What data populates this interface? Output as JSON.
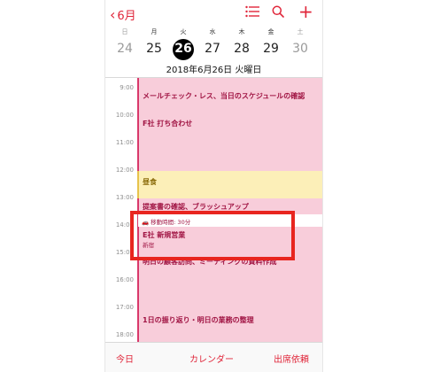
{
  "nav": {
    "back_label": "6月"
  },
  "week": {
    "weekdays": [
      "日",
      "月",
      "火",
      "水",
      "木",
      "金",
      "土"
    ],
    "dates": [
      "24",
      "25",
      "26",
      "27",
      "28",
      "29",
      "30"
    ],
    "selected_index": 2
  },
  "selected_date_caption": "2018年6月26日 火曜日",
  "timeline": {
    "hours": [
      "9:00",
      "10:00",
      "11:00",
      "12:00",
      "13:00",
      "14:00",
      "15:00",
      "16:00",
      "17:00",
      "18:00"
    ]
  },
  "events": [
    {
      "title": "メールチェック・レス、当日のスケジュールの確認"
    },
    {
      "title": "F社 打ち合わせ"
    },
    {
      "title": "昼食"
    },
    {
      "title": "提案書の確認、ブラッシュアップ"
    },
    {
      "title": "E社 新規営業",
      "location": "新宿",
      "travel": "移動時間: 30分"
    },
    {
      "title": "明日の顧客訪問、ミーティングの資料作成"
    },
    {
      "title": "1日の振り返り・明日の業務の整理"
    }
  ],
  "toolbar": {
    "today": "今日",
    "calendars": "カレンダー",
    "inbox": "出席依頼"
  },
  "colors": {
    "accent": "#e0263a",
    "event_pink": "#f8cdda",
    "event_yellow": "#fcefb8",
    "highlight": "#e8251f"
  }
}
